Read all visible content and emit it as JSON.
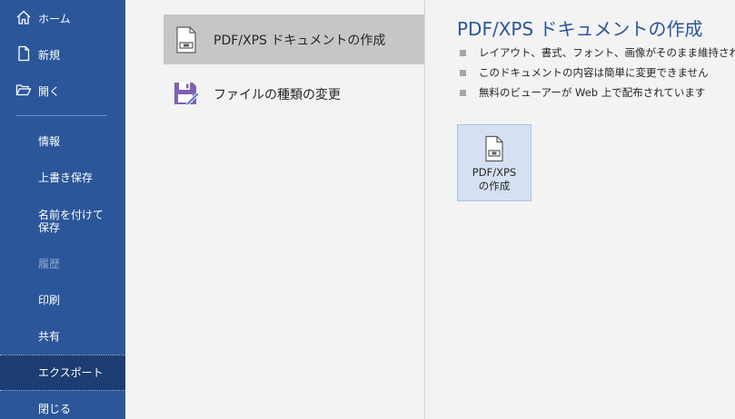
{
  "sidebar": {
    "home": "ホーム",
    "new": "新規",
    "open": "開く",
    "items": [
      {
        "label": "情報"
      },
      {
        "label": "上書き保存"
      },
      {
        "label": "名前を付けて保存"
      },
      {
        "label": "履歴"
      },
      {
        "label": "印刷"
      },
      {
        "label": "共有"
      },
      {
        "label": "エクスポート"
      },
      {
        "label": "閉じる"
      }
    ]
  },
  "export_options": [
    {
      "label": "PDF/XPS ドキュメントの作成"
    },
    {
      "label": "ファイルの種類の変更"
    }
  ],
  "detail": {
    "title": "PDF/XPS ドキュメントの作成",
    "bullets": [
      "レイアウト、書式、フォント、画像がそのまま維持されます",
      "このドキュメントの内容は簡単に変更できません",
      "無料のビューアーが Web 上で配布されています"
    ],
    "button_line1": "PDF/XPS",
    "button_line2": "の作成"
  },
  "colors": {
    "sidebar": "#2b579a",
    "sidebar_active": "#1c3d71",
    "heading": "#2b579a",
    "selected_option": "#c6c6c6",
    "button_bg": "#d5e1f2"
  }
}
